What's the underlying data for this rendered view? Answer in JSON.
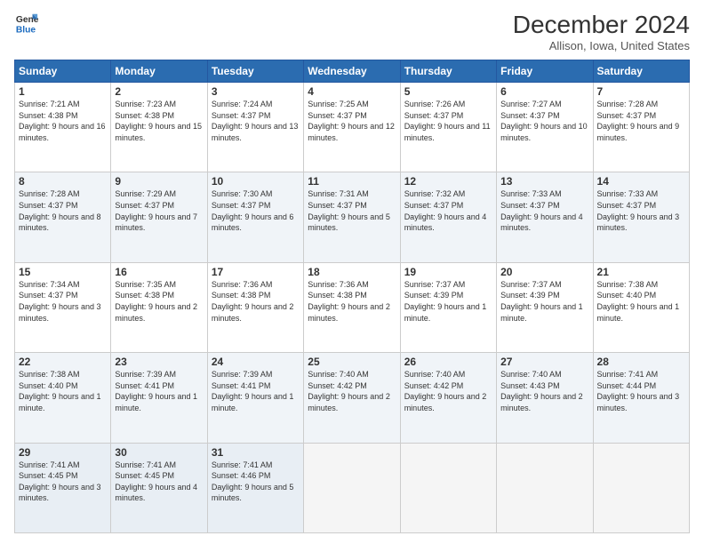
{
  "logo": {
    "line1": "General",
    "line2": "Blue"
  },
  "title": "December 2024",
  "location": "Allison, Iowa, United States",
  "days_of_week": [
    "Sunday",
    "Monday",
    "Tuesday",
    "Wednesday",
    "Thursday",
    "Friday",
    "Saturday"
  ],
  "weeks": [
    [
      {
        "day": "1",
        "sunrise": "7:21 AM",
        "sunset": "4:38 PM",
        "daylight": "9 hours and 16 minutes."
      },
      {
        "day": "2",
        "sunrise": "7:23 AM",
        "sunset": "4:38 PM",
        "daylight": "9 hours and 15 minutes."
      },
      {
        "day": "3",
        "sunrise": "7:24 AM",
        "sunset": "4:37 PM",
        "daylight": "9 hours and 13 minutes."
      },
      {
        "day": "4",
        "sunrise": "7:25 AM",
        "sunset": "4:37 PM",
        "daylight": "9 hours and 12 minutes."
      },
      {
        "day": "5",
        "sunrise": "7:26 AM",
        "sunset": "4:37 PM",
        "daylight": "9 hours and 11 minutes."
      },
      {
        "day": "6",
        "sunrise": "7:27 AM",
        "sunset": "4:37 PM",
        "daylight": "9 hours and 10 minutes."
      },
      {
        "day": "7",
        "sunrise": "7:28 AM",
        "sunset": "4:37 PM",
        "daylight": "9 hours and 9 minutes."
      }
    ],
    [
      {
        "day": "8",
        "sunrise": "7:28 AM",
        "sunset": "4:37 PM",
        "daylight": "9 hours and 8 minutes."
      },
      {
        "day": "9",
        "sunrise": "7:29 AM",
        "sunset": "4:37 PM",
        "daylight": "9 hours and 7 minutes."
      },
      {
        "day": "10",
        "sunrise": "7:30 AM",
        "sunset": "4:37 PM",
        "daylight": "9 hours and 6 minutes."
      },
      {
        "day": "11",
        "sunrise": "7:31 AM",
        "sunset": "4:37 PM",
        "daylight": "9 hours and 5 minutes."
      },
      {
        "day": "12",
        "sunrise": "7:32 AM",
        "sunset": "4:37 PM",
        "daylight": "9 hours and 4 minutes."
      },
      {
        "day": "13",
        "sunrise": "7:33 AM",
        "sunset": "4:37 PM",
        "daylight": "9 hours and 4 minutes."
      },
      {
        "day": "14",
        "sunrise": "7:33 AM",
        "sunset": "4:37 PM",
        "daylight": "9 hours and 3 minutes."
      }
    ],
    [
      {
        "day": "15",
        "sunrise": "7:34 AM",
        "sunset": "4:37 PM",
        "daylight": "9 hours and 3 minutes."
      },
      {
        "day": "16",
        "sunrise": "7:35 AM",
        "sunset": "4:38 PM",
        "daylight": "9 hours and 2 minutes."
      },
      {
        "day": "17",
        "sunrise": "7:36 AM",
        "sunset": "4:38 PM",
        "daylight": "9 hours and 2 minutes."
      },
      {
        "day": "18",
        "sunrise": "7:36 AM",
        "sunset": "4:38 PM",
        "daylight": "9 hours and 2 minutes."
      },
      {
        "day": "19",
        "sunrise": "7:37 AM",
        "sunset": "4:39 PM",
        "daylight": "9 hours and 1 minute."
      },
      {
        "day": "20",
        "sunrise": "7:37 AM",
        "sunset": "4:39 PM",
        "daylight": "9 hours and 1 minute."
      },
      {
        "day": "21",
        "sunrise": "7:38 AM",
        "sunset": "4:40 PM",
        "daylight": "9 hours and 1 minute."
      }
    ],
    [
      {
        "day": "22",
        "sunrise": "7:38 AM",
        "sunset": "4:40 PM",
        "daylight": "9 hours and 1 minute."
      },
      {
        "day": "23",
        "sunrise": "7:39 AM",
        "sunset": "4:41 PM",
        "daylight": "9 hours and 1 minute."
      },
      {
        "day": "24",
        "sunrise": "7:39 AM",
        "sunset": "4:41 PM",
        "daylight": "9 hours and 1 minute."
      },
      {
        "day": "25",
        "sunrise": "7:40 AM",
        "sunset": "4:42 PM",
        "daylight": "9 hours and 2 minutes."
      },
      {
        "day": "26",
        "sunrise": "7:40 AM",
        "sunset": "4:42 PM",
        "daylight": "9 hours and 2 minutes."
      },
      {
        "day": "27",
        "sunrise": "7:40 AM",
        "sunset": "4:43 PM",
        "daylight": "9 hours and 2 minutes."
      },
      {
        "day": "28",
        "sunrise": "7:41 AM",
        "sunset": "4:44 PM",
        "daylight": "9 hours and 3 minutes."
      }
    ],
    [
      {
        "day": "29",
        "sunrise": "7:41 AM",
        "sunset": "4:45 PM",
        "daylight": "9 hours and 3 minutes."
      },
      {
        "day": "30",
        "sunrise": "7:41 AM",
        "sunset": "4:45 PM",
        "daylight": "9 hours and 4 minutes."
      },
      {
        "day": "31",
        "sunrise": "7:41 AM",
        "sunset": "4:46 PM",
        "daylight": "9 hours and 5 minutes."
      },
      null,
      null,
      null,
      null
    ]
  ]
}
